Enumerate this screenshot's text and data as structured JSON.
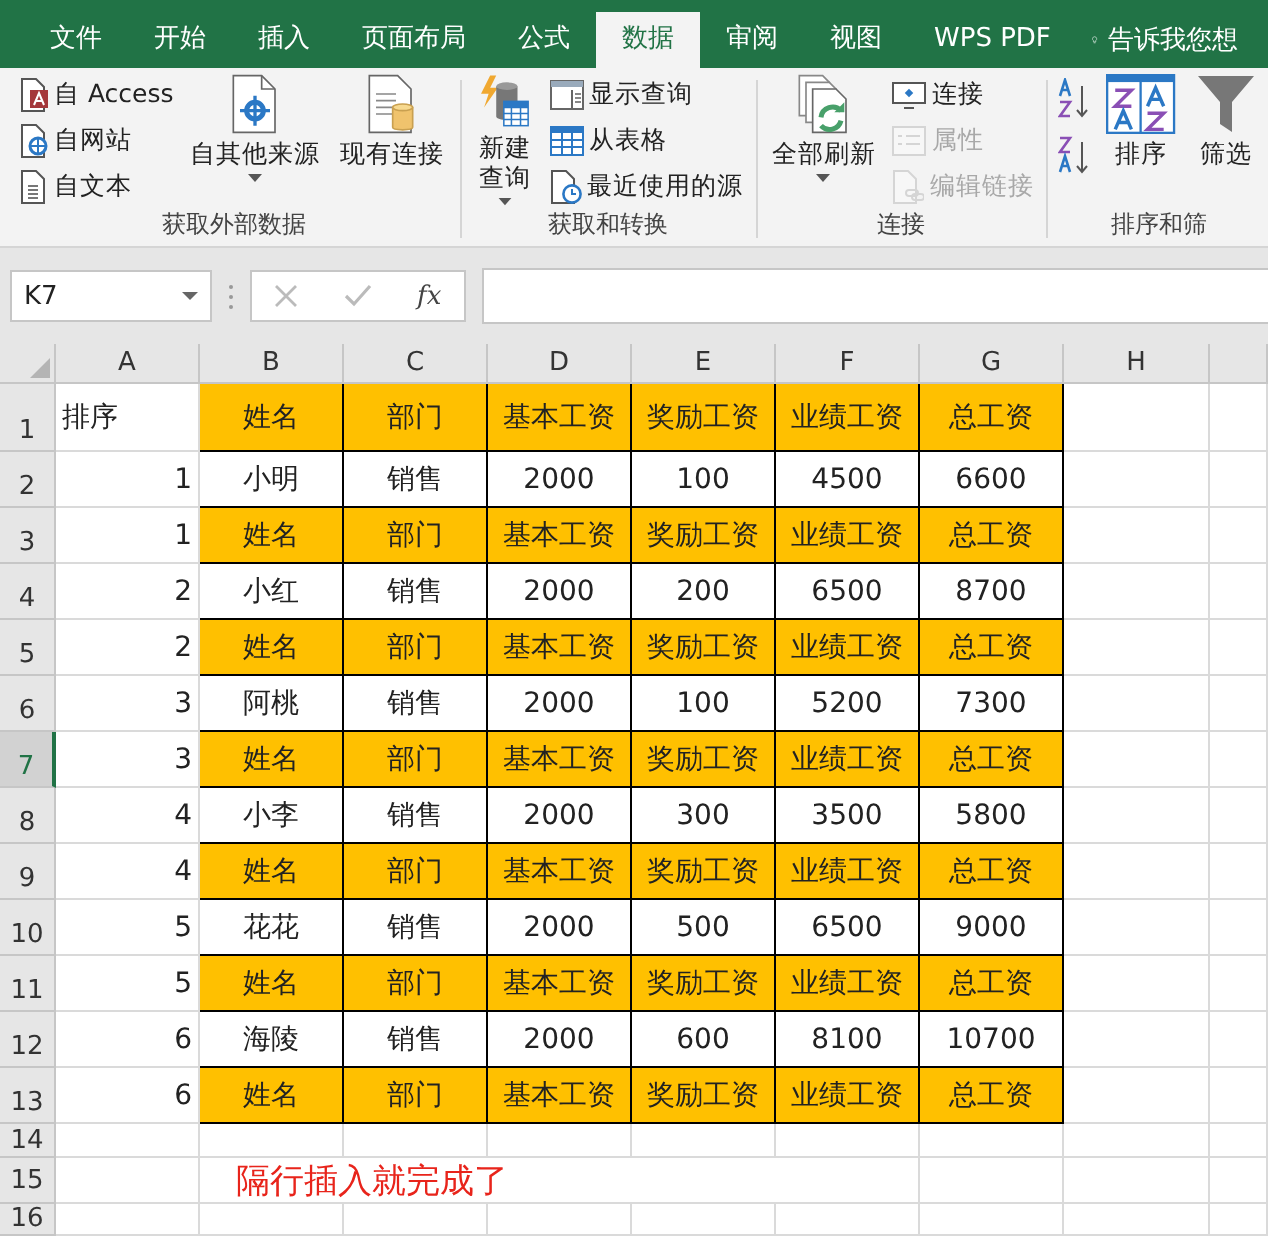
{
  "tabs": [
    {
      "label": "文件",
      "selected": false
    },
    {
      "label": "开始",
      "selected": false
    },
    {
      "label": "插入",
      "selected": false
    },
    {
      "label": "页面布局",
      "selected": false
    },
    {
      "label": "公式",
      "selected": false
    },
    {
      "label": "数据",
      "selected": true
    },
    {
      "label": "审阅",
      "selected": false
    },
    {
      "label": "视图",
      "selected": false
    },
    {
      "label": "WPS PDF",
      "selected": false
    }
  ],
  "tell_me": {
    "placeholder": "告诉我您想"
  },
  "ribbon": {
    "groups": [
      {
        "label": "获取外部数据",
        "items": [
          {
            "kind": "stack",
            "buttons": [
              {
                "label": "自 Access",
                "disabled": false
              },
              {
                "label": "自网站",
                "disabled": false
              },
              {
                "label": "自文本",
                "disabled": false
              }
            ]
          },
          {
            "kind": "large",
            "lines": [
              "自其他来源"
            ],
            "dropdown": true
          },
          {
            "kind": "large",
            "lines": [
              "现有连接"
            ],
            "dropdown": false
          }
        ]
      },
      {
        "label": "获取和转换",
        "items": [
          {
            "kind": "large",
            "lines": [
              "新建",
              "查询"
            ],
            "dropdown": true
          },
          {
            "kind": "stack",
            "buttons": [
              {
                "label": "显示查询",
                "disabled": false
              },
              {
                "label": "从表格",
                "disabled": false
              },
              {
                "label": "最近使用的源",
                "disabled": false
              }
            ]
          }
        ]
      },
      {
        "label": "连接",
        "items": [
          {
            "kind": "large",
            "lines": [
              "全部刷新"
            ],
            "dropdown": true
          },
          {
            "kind": "stack",
            "buttons": [
              {
                "label": "连接",
                "disabled": false
              },
              {
                "label": "属性",
                "disabled": true
              },
              {
                "label": "编辑链接",
                "disabled": true
              }
            ]
          }
        ]
      },
      {
        "label": "排序和筛",
        "items": [
          {
            "kind": "stack",
            "buttons": [
              {
                "disabled": false
              },
              {
                "disabled": false
              }
            ]
          },
          {
            "kind": "large",
            "lines": [
              "排序"
            ],
            "dropdown": false
          },
          {
            "kind": "large",
            "lines": [
              "筛选"
            ],
            "dropdown": false
          }
        ]
      }
    ]
  },
  "formula_bar": {
    "name_box": "K7",
    "function_label": "fx"
  },
  "sheet": {
    "columns": [
      "A",
      "B",
      "C",
      "D",
      "E",
      "F",
      "G",
      "H"
    ],
    "rows": [
      {
        "number": "1",
        "kind": "title",
        "selected": false,
        "cells": [
          "排序",
          "姓名",
          "部门",
          "基本工资",
          "奖励工资",
          "业绩工资",
          "总工资"
        ]
      },
      {
        "number": "2",
        "kind": "data",
        "selected": false,
        "cells": [
          "1",
          "小明",
          "销售",
          "2000",
          "100",
          "4500",
          "6600"
        ]
      },
      {
        "number": "3",
        "kind": "header",
        "selected": false,
        "cells": [
          "1",
          "姓名",
          "部门",
          "基本工资",
          "奖励工资",
          "业绩工资",
          "总工资"
        ]
      },
      {
        "number": "4",
        "kind": "data",
        "selected": false,
        "cells": [
          "2",
          "小红",
          "销售",
          "2000",
          "200",
          "6500",
          "8700"
        ]
      },
      {
        "number": "5",
        "kind": "header",
        "selected": false,
        "cells": [
          "2",
          "姓名",
          "部门",
          "基本工资",
          "奖励工资",
          "业绩工资",
          "总工资"
        ]
      },
      {
        "number": "6",
        "kind": "data",
        "selected": false,
        "cells": [
          "3",
          "阿桃",
          "销售",
          "2000",
          "100",
          "5200",
          "7300"
        ]
      },
      {
        "number": "7",
        "kind": "header",
        "selected": true,
        "cells": [
          "3",
          "姓名",
          "部门",
          "基本工资",
          "奖励工资",
          "业绩工资",
          "总工资"
        ]
      },
      {
        "number": "8",
        "kind": "data",
        "selected": false,
        "cells": [
          "4",
          "小李",
          "销售",
          "2000",
          "300",
          "3500",
          "5800"
        ]
      },
      {
        "number": "9",
        "kind": "header",
        "selected": false,
        "cells": [
          "4",
          "姓名",
          "部门",
          "基本工资",
          "奖励工资",
          "业绩工资",
          "总工资"
        ]
      },
      {
        "number": "10",
        "kind": "data",
        "selected": false,
        "cells": [
          "5",
          "花花",
          "销售",
          "2000",
          "500",
          "6500",
          "9000"
        ]
      },
      {
        "number": "11",
        "kind": "header",
        "selected": false,
        "cells": [
          "5",
          "姓名",
          "部门",
          "基本工资",
          "奖励工资",
          "业绩工资",
          "总工资"
        ]
      },
      {
        "number": "12",
        "kind": "data",
        "selected": false,
        "cells": [
          "6",
          "海陵",
          "销售",
          "2000",
          "600",
          "8100",
          "10700"
        ]
      },
      {
        "number": "13",
        "kind": "header",
        "selected": false,
        "cells": [
          "6",
          "姓名",
          "部门",
          "基本工资",
          "奖励工资",
          "业绩工资",
          "总工资"
        ]
      },
      {
        "number": "14",
        "kind": "empty",
        "selected": false
      },
      {
        "number": "15",
        "kind": "empty",
        "selected": false,
        "note": "隔行插入就完成了"
      },
      {
        "number": "16",
        "kind": "empty",
        "selected": false
      }
    ]
  }
}
